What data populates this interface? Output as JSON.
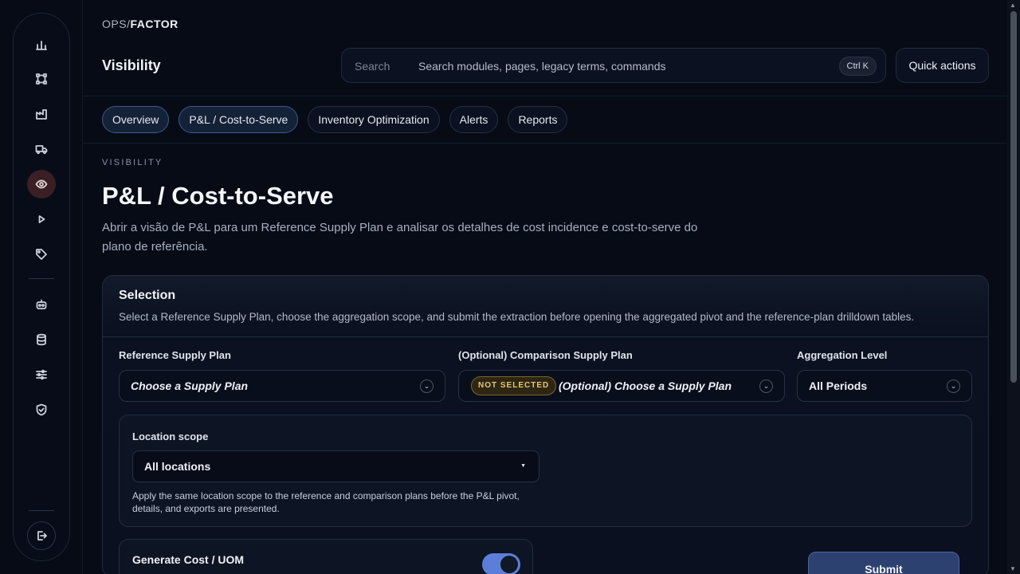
{
  "brand": {
    "prefix": "OPS",
    "slash": "/",
    "suffix": "FACTOR"
  },
  "header": {
    "section": "Visibility",
    "search_label": "Search",
    "search_placeholder": "Search modules, pages, legacy terms, commands",
    "shortcut": "Ctrl K",
    "quick_actions": "Quick actions"
  },
  "sidebar": {
    "items": [
      {
        "icon": "bar-chart-icon"
      },
      {
        "icon": "network-icon"
      },
      {
        "icon": "factory-icon"
      },
      {
        "icon": "truck-icon"
      },
      {
        "icon": "eye-icon",
        "active": true
      },
      {
        "icon": "play-icon"
      },
      {
        "icon": "tag-icon"
      },
      {
        "icon": "robot-icon"
      },
      {
        "icon": "database-icon"
      },
      {
        "icon": "sliders-icon"
      },
      {
        "icon": "shield-check-icon"
      },
      {
        "icon": "logout-icon"
      }
    ]
  },
  "tabs": [
    {
      "label": "Overview",
      "active": true
    },
    {
      "label": "P&L / Cost-to-Serve",
      "active": true
    },
    {
      "label": "Inventory Optimization"
    },
    {
      "label": "Alerts"
    },
    {
      "label": "Reports"
    }
  ],
  "page": {
    "eyebrow": "VISIBILITY",
    "title": "P&L / Cost-to-Serve",
    "description": "Abrir a visão de P&L para um Reference Supply Plan e analisar os detalhes de cost incidence e cost-to-serve do plano de referência."
  },
  "selection": {
    "title": "Selection",
    "subtitle": "Select a Reference Supply Plan, choose the aggregation scope, and submit the extraction before opening the aggregated pivot and the reference-plan drilldown tables.",
    "reference": {
      "label": "Reference Supply Plan",
      "value": "Choose a Supply Plan"
    },
    "comparison": {
      "label": "(Optional) Comparison Supply Plan",
      "badge": "NOT SELECTED",
      "value": "(Optional) Choose a Supply Plan"
    },
    "aggregation": {
      "label": "Aggregation Level",
      "value": "All Periods"
    },
    "location": {
      "label": "Location scope",
      "value": "All locations",
      "help": "Apply the same location scope to the reference and comparison plans before the P&L pivot, details, and exports are presented."
    },
    "generate_cost": {
      "label": "Generate Cost / UOM",
      "on": true
    },
    "submit": "Submit"
  },
  "colors": {
    "accent": "#5b7fd8",
    "active_tab_border": "#3c5a8a",
    "badge": "#e2c77a"
  }
}
